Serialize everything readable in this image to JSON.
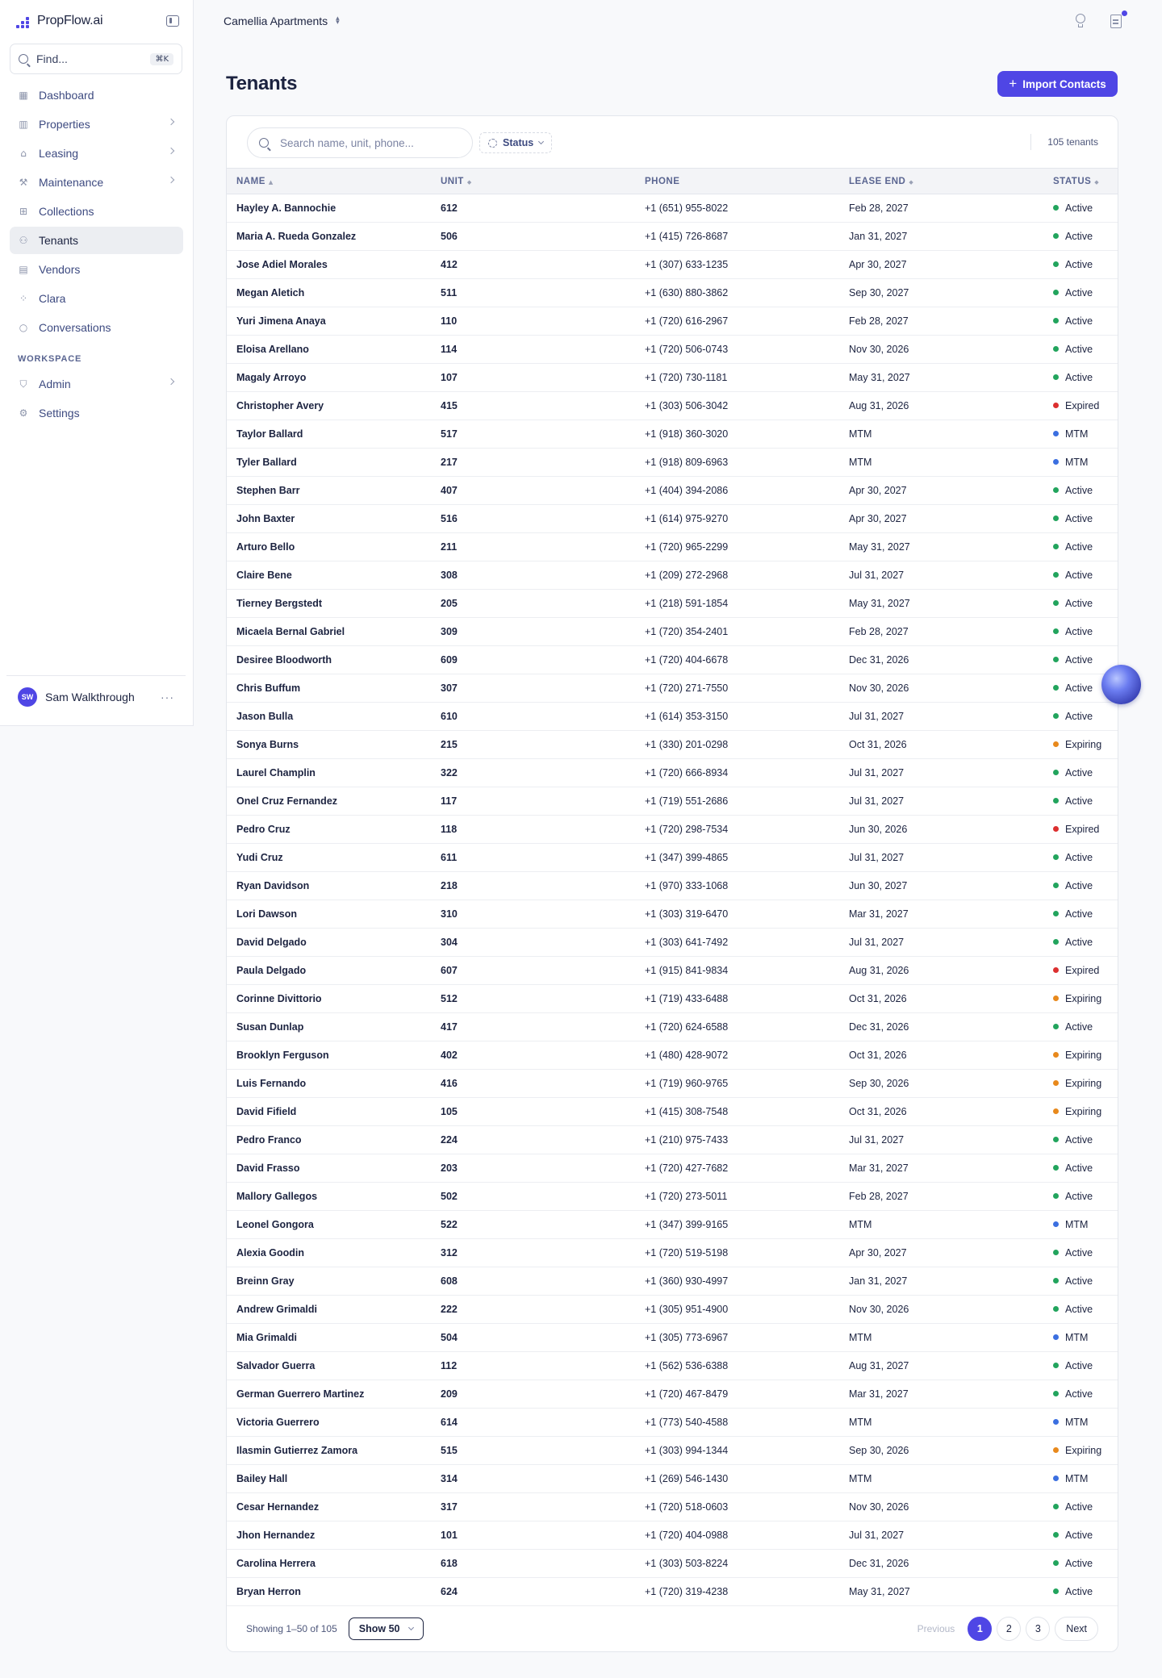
{
  "app": {
    "name": "PropFlow.ai"
  },
  "sidebar": {
    "find_placeholder": "Find...",
    "find_shortcut": "⌘K",
    "nav": [
      {
        "label": "Dashboard",
        "icon": "dashboard-icon",
        "chevron": false,
        "active": false
      },
      {
        "label": "Properties",
        "icon": "building-icon",
        "chevron": true,
        "active": false
      },
      {
        "label": "Leasing",
        "icon": "house-icon",
        "chevron": true,
        "active": false
      },
      {
        "label": "Maintenance",
        "icon": "wrench-icon",
        "chevron": true,
        "active": false
      },
      {
        "label": "Collections",
        "icon": "bank-icon",
        "chevron": false,
        "active": false
      },
      {
        "label": "Tenants",
        "icon": "users-icon",
        "chevron": false,
        "active": true
      },
      {
        "label": "Vendors",
        "icon": "store-icon",
        "chevron": false,
        "active": false
      },
      {
        "label": "Clara",
        "icon": "clara-icon",
        "chevron": false,
        "active": false
      },
      {
        "label": "Conversations",
        "icon": "chat-icon",
        "chevron": false,
        "active": false
      }
    ],
    "workspace_label": "WORKSPACE",
    "workspace_nav": [
      {
        "label": "Admin",
        "icon": "shield-icon",
        "chevron": true
      },
      {
        "label": "Settings",
        "icon": "gear-icon",
        "chevron": false
      }
    ],
    "user": {
      "initials": "SW",
      "name": "Sam Walkthrough",
      "more": "···"
    }
  },
  "topbar": {
    "property": "Camellia Apartments"
  },
  "page": {
    "title": "Tenants",
    "import_label": "Import Contacts"
  },
  "table": {
    "search_placeholder": "Search name, unit, phone...",
    "status_filter": "Status",
    "tenant_count": "105 tenants",
    "columns": [
      "NAME",
      "UNIT",
      "PHONE",
      "LEASE END",
      "STATUS"
    ],
    "status_colors": {
      "Active": "#22a45d",
      "Expired": "#dc2f2f",
      "MTM": "#3b6fe0",
      "Expiring": "#e8891c"
    },
    "rows": [
      [
        "Hayley A. Bannochie",
        "612",
        "+1 (651) 955-8022",
        "Feb 28, 2027",
        "Active"
      ],
      [
        "Maria A. Rueda Gonzalez",
        "506",
        "+1 (415) 726-8687",
        "Jan 31, 2027",
        "Active"
      ],
      [
        "Jose Adiel Morales",
        "412",
        "+1 (307) 633-1235",
        "Apr 30, 2027",
        "Active"
      ],
      [
        "Megan Aletich",
        "511",
        "+1 (630) 880-3862",
        "Sep 30, 2027",
        "Active"
      ],
      [
        "Yuri Jimena Anaya",
        "110",
        "+1 (720) 616-2967",
        "Feb 28, 2027",
        "Active"
      ],
      [
        "Eloisa Arellano",
        "114",
        "+1 (720) 506-0743",
        "Nov 30, 2026",
        "Active"
      ],
      [
        "Magaly Arroyo",
        "107",
        "+1 (720) 730-1181",
        "May 31, 2027",
        "Active"
      ],
      [
        "Christopher Avery",
        "415",
        "+1 (303) 506-3042",
        "Aug 31, 2026",
        "Expired"
      ],
      [
        "Taylor Ballard",
        "517",
        "+1 (918) 360-3020",
        "MTM",
        "MTM"
      ],
      [
        "Tyler Ballard",
        "217",
        "+1 (918) 809-6963",
        "MTM",
        "MTM"
      ],
      [
        "Stephen Barr",
        "407",
        "+1 (404) 394-2086",
        "Apr 30, 2027",
        "Active"
      ],
      [
        "John Baxter",
        "516",
        "+1 (614) 975-9270",
        "Apr 30, 2027",
        "Active"
      ],
      [
        "Arturo Bello",
        "211",
        "+1 (720) 965-2299",
        "May 31, 2027",
        "Active"
      ],
      [
        "Claire Bene",
        "308",
        "+1 (209) 272-2968",
        "Jul 31, 2027",
        "Active"
      ],
      [
        "Tierney Bergstedt",
        "205",
        "+1 (218) 591-1854",
        "May 31, 2027",
        "Active"
      ],
      [
        "Micaela Bernal Gabriel",
        "309",
        "+1 (720) 354-2401",
        "Feb 28, 2027",
        "Active"
      ],
      [
        "Desiree Bloodworth",
        "609",
        "+1 (720) 404-6678",
        "Dec 31, 2026",
        "Active"
      ],
      [
        "Chris Buffum",
        "307",
        "+1 (720) 271-7550",
        "Nov 30, 2026",
        "Active"
      ],
      [
        "Jason Bulla",
        "610",
        "+1 (614) 353-3150",
        "Jul 31, 2027",
        "Active"
      ],
      [
        "Sonya Burns",
        "215",
        "+1 (330) 201-0298",
        "Oct 31, 2026",
        "Expiring"
      ],
      [
        "Laurel Champlin",
        "322",
        "+1 (720) 666-8934",
        "Jul 31, 2027",
        "Active"
      ],
      [
        "Onel Cruz Fernandez",
        "117",
        "+1 (719) 551-2686",
        "Jul 31, 2027",
        "Active"
      ],
      [
        "Pedro Cruz",
        "118",
        "+1 (720) 298-7534",
        "Jun 30, 2026",
        "Expired"
      ],
      [
        "Yudi Cruz",
        "611",
        "+1 (347) 399-4865",
        "Jul 31, 2027",
        "Active"
      ],
      [
        "Ryan Davidson",
        "218",
        "+1 (970) 333-1068",
        "Jun 30, 2027",
        "Active"
      ],
      [
        "Lori Dawson",
        "310",
        "+1 (303) 319-6470",
        "Mar 31, 2027",
        "Active"
      ],
      [
        "David Delgado",
        "304",
        "+1 (303) 641-7492",
        "Jul 31, 2027",
        "Active"
      ],
      [
        "Paula Delgado",
        "607",
        "+1 (915) 841-9834",
        "Aug 31, 2026",
        "Expired"
      ],
      [
        "Corinne Divittorio",
        "512",
        "+1 (719) 433-6488",
        "Oct 31, 2026",
        "Expiring"
      ],
      [
        "Susan Dunlap",
        "417",
        "+1 (720) 624-6588",
        "Dec 31, 2026",
        "Active"
      ],
      [
        "Brooklyn Ferguson",
        "402",
        "+1 (480) 428-9072",
        "Oct 31, 2026",
        "Expiring"
      ],
      [
        "Luis Fernando",
        "416",
        "+1 (719) 960-9765",
        "Sep 30, 2026",
        "Expiring"
      ],
      [
        "David Fifield",
        "105",
        "+1 (415) 308-7548",
        "Oct 31, 2026",
        "Expiring"
      ],
      [
        "Pedro Franco",
        "224",
        "+1 (210) 975-7433",
        "Jul 31, 2027",
        "Active"
      ],
      [
        "David Frasso",
        "203",
        "+1 (720) 427-7682",
        "Mar 31, 2027",
        "Active"
      ],
      [
        "Mallory Gallegos",
        "502",
        "+1 (720) 273-5011",
        "Feb 28, 2027",
        "Active"
      ],
      [
        "Leonel Gongora",
        "522",
        "+1 (347) 399-9165",
        "MTM",
        "MTM"
      ],
      [
        "Alexia Goodin",
        "312",
        "+1 (720) 519-5198",
        "Apr 30, 2027",
        "Active"
      ],
      [
        "Breinn Gray",
        "608",
        "+1 (360) 930-4997",
        "Jan 31, 2027",
        "Active"
      ],
      [
        "Andrew Grimaldi",
        "222",
        "+1 (305) 951-4900",
        "Nov 30, 2026",
        "Active"
      ],
      [
        "Mia Grimaldi",
        "504",
        "+1 (305) 773-6967",
        "MTM",
        "MTM"
      ],
      [
        "Salvador Guerra",
        "112",
        "+1 (562) 536-6388",
        "Aug 31, 2027",
        "Active"
      ],
      [
        "German Guerrero Martinez",
        "209",
        "+1 (720) 467-8479",
        "Mar 31, 2027",
        "Active"
      ],
      [
        "Victoria Guerrero",
        "614",
        "+1 (773) 540-4588",
        "MTM",
        "MTM"
      ],
      [
        "Ilasmin Gutierrez Zamora",
        "515",
        "+1 (303) 994-1344",
        "Sep 30, 2026",
        "Expiring"
      ],
      [
        "Bailey Hall",
        "314",
        "+1 (269) 546-1430",
        "MTM",
        "MTM"
      ],
      [
        "Cesar Hernandez",
        "317",
        "+1 (720) 518-0603",
        "Nov 30, 2026",
        "Active"
      ],
      [
        "Jhon Hernandez",
        "101",
        "+1 (720) 404-0988",
        "Jul 31, 2027",
        "Active"
      ],
      [
        "Carolina Herrera",
        "618",
        "+1 (303) 503-8224",
        "Dec 31, 2026",
        "Active"
      ],
      [
        "Bryan Herron",
        "624",
        "+1 (720) 319-4238",
        "May 31, 2027",
        "Active"
      ]
    ]
  },
  "pagination": {
    "showing": "Showing 1–50 of 105",
    "page_size": "Show 50",
    "previous": "Previous",
    "pages": [
      "1",
      "2",
      "3"
    ],
    "current": "1",
    "next": "Next"
  }
}
